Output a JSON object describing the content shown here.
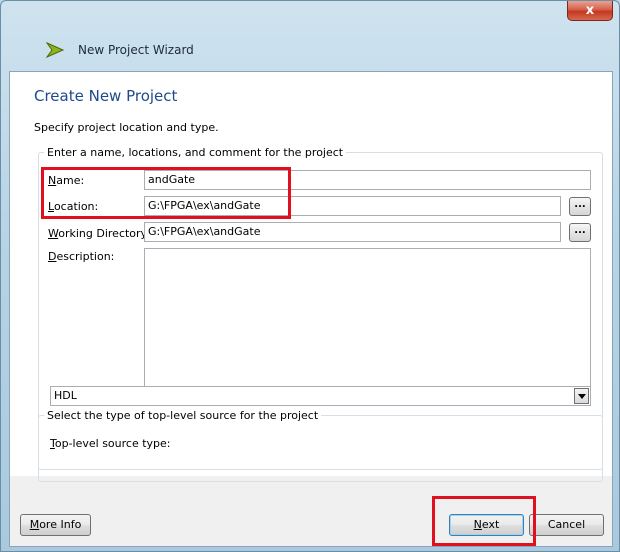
{
  "window": {
    "title": "New Project Wizard",
    "close_glyph": "x",
    "app_icon": "ise-wizard-arrow-icon"
  },
  "page": {
    "heading": "Create New Project",
    "description": "Specify project location and type."
  },
  "project_group": {
    "legend": "Enter a name, locations, and comment for the project",
    "name": {
      "label_u": "N",
      "label_rest": "ame:",
      "value": "andGate"
    },
    "location": {
      "label_u": "L",
      "label_rest": "ocation:",
      "value": "G:\\FPGA\\ex\\andGate",
      "browse": "..."
    },
    "working_dir": {
      "label_u": "W",
      "label_rest": "orking Directory:",
      "value": "G:\\FPGA\\ex\\andGate",
      "browse": "..."
    },
    "description": {
      "label_u": "D",
      "label_rest": "escription:",
      "value": ""
    }
  },
  "source_group": {
    "legend": "Select the type of top-level source for the project",
    "label_u": "T",
    "label_rest": "op-level source type:",
    "selected": "HDL"
  },
  "buttons": {
    "more_info": {
      "u": "M",
      "rest": "ore Info"
    },
    "next": {
      "u": "N",
      "rest": "ext"
    },
    "cancel": "Cancel"
  },
  "colors": {
    "highlight": "#e0101e",
    "heading": "#1e4a8a"
  }
}
